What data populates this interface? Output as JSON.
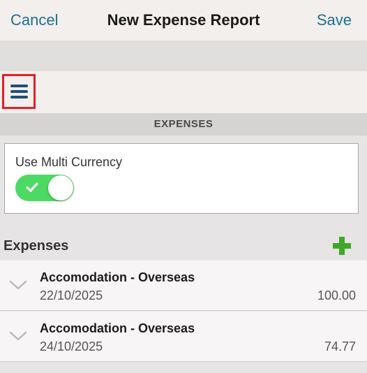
{
  "nav": {
    "cancel_label": "Cancel",
    "title": "New Expense Report",
    "save_label": "Save"
  },
  "toolbar": {
    "menu_icon": "hamburger-menu-icon"
  },
  "section": {
    "header": "EXPENSES"
  },
  "multi_currency": {
    "label": "Use Multi Currency",
    "enabled": true
  },
  "expenses": {
    "title": "Expenses",
    "add_icon": "plus-icon",
    "items": [
      {
        "name": "Accomodation - Overseas",
        "date": "22/10/2025",
        "amount": "100.00"
      },
      {
        "name": "Accomodation - Overseas",
        "date": "24/10/2025",
        "amount": "74.77"
      }
    ]
  },
  "colors": {
    "accent": "#1f6f93",
    "toggle_on": "#4cd964",
    "add_green": "#3fa82c",
    "highlight_border": "#e0202b"
  }
}
